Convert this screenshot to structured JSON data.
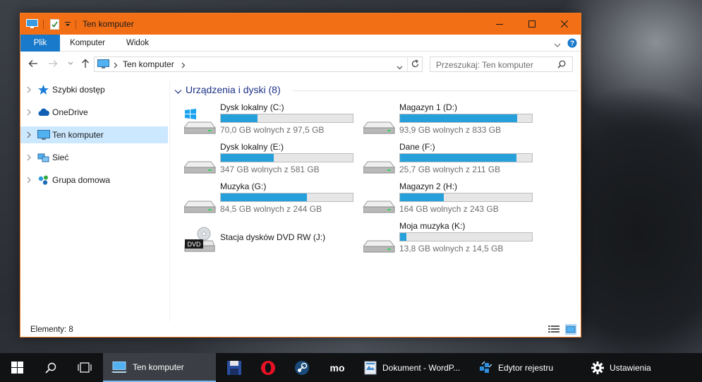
{
  "window": {
    "title": "Ten komputer",
    "accent_color": "#f36f16"
  },
  "ribbon": {
    "tabs": [
      {
        "label": "Plik"
      },
      {
        "label": "Komputer"
      },
      {
        "label": "Widok"
      }
    ]
  },
  "address": {
    "path": "Ten komputer",
    "search_placeholder": "Przeszukaj: Ten komputer"
  },
  "nav": {
    "items": [
      {
        "label": "Szybki dostęp",
        "icon": "star-icon"
      },
      {
        "label": "OneDrive",
        "icon": "cloud-icon"
      },
      {
        "label": "Ten komputer",
        "icon": "computer-icon",
        "selected": true
      },
      {
        "label": "Sieć",
        "icon": "network-icon"
      },
      {
        "label": "Grupa domowa",
        "icon": "homegroup-icon"
      }
    ]
  },
  "content": {
    "group_title": "Urządzenia i dyski (8)",
    "drives": [
      {
        "name": "Dysk lokalny (C:)",
        "free_text": "70,0 GB wolnych z 97,5 GB",
        "used_fraction": 0.28,
        "icon": "windows-drive-icon"
      },
      {
        "name": "Magazyn 1 (D:)",
        "free_text": "93,9 GB wolnych z 833 GB",
        "used_fraction": 0.89,
        "icon": "hard-drive-icon"
      },
      {
        "name": "Dysk lokalny (E:)",
        "free_text": "347 GB wolnych z 581 GB",
        "used_fraction": 0.4,
        "icon": "hard-drive-icon"
      },
      {
        "name": "Dane (F:)",
        "free_text": "25,7 GB wolnych z 211 GB",
        "used_fraction": 0.88,
        "icon": "hard-drive-icon"
      },
      {
        "name": "Muzyka (G:)",
        "free_text": "84,5 GB wolnych z 244 GB",
        "used_fraction": 0.65,
        "icon": "hard-drive-icon"
      },
      {
        "name": "Magazyn 2 (H:)",
        "free_text": "164 GB wolnych z 243 GB",
        "used_fraction": 0.33,
        "icon": "hard-drive-icon"
      },
      {
        "name": "Stacja dysków DVD RW (J:)",
        "free_text": "",
        "used_fraction": null,
        "icon": "dvd-drive-icon",
        "dvd_label": "DVD"
      },
      {
        "name": "Moja muzyka (K:)",
        "free_text": "13,8 GB wolnych z 14,5 GB",
        "used_fraction": 0.05,
        "icon": "hard-drive-icon"
      }
    ]
  },
  "status": {
    "items_text": "Elementy: 8"
  },
  "taskbar": {
    "items": [
      {
        "label": "Ten komputer",
        "icon": "file-explorer-icon",
        "active": true
      },
      {
        "label": "Dokument - WordP...",
        "icon": "wordpad-icon"
      },
      {
        "label": "Edytor rejestru",
        "icon": "registry-editor-icon"
      },
      {
        "label": "Ustawienia",
        "icon": "settings-gear-icon"
      }
    ],
    "pinned_icons": [
      "save-disk-icon",
      "opera-icon",
      "steam-icon",
      "mo-icon"
    ]
  }
}
